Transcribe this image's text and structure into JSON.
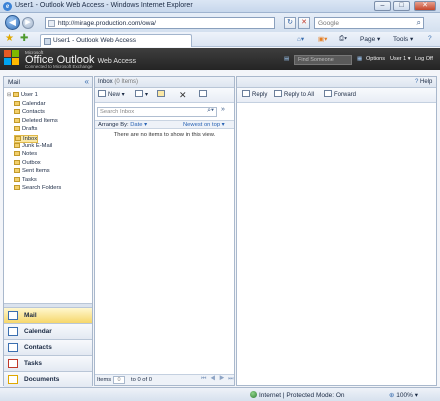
{
  "window": {
    "title": "User1 - Outlook Web Access - Windows Internet Explorer",
    "min_icon": "minimize-icon",
    "max_icon": "maximize-icon",
    "close_icon": "close-icon"
  },
  "address": {
    "url": "http://mirage.production.com/owa/",
    "refresh": "↻",
    "stop": "✕",
    "search_placeholder": "Google"
  },
  "tab": {
    "label": "User1 - Outlook Web Access"
  },
  "commands": {
    "page": "Page ▾",
    "tools": "Tools ▾",
    "help": "?"
  },
  "owa": {
    "microsoft": "Microsoft",
    "product": "Office Outlook",
    "product_suffix": "Web Access",
    "subtitle": "Connected to Microsoft Exchange",
    "find_placeholder": "Find Someone",
    "options": "Options",
    "user": "User 1 ▾",
    "logoff": "Log Off",
    "brand_colors": [
      "#e65a24",
      "#7fba00",
      "#00a4ef",
      "#ffb900"
    ]
  },
  "left": {
    "header": "Mail",
    "collapse": "«",
    "root": "User 1",
    "folders": [
      "Calendar",
      "Contacts",
      "Deleted Items",
      "Drafts",
      "Inbox",
      "Junk E-Mail",
      "Notes",
      "Outbox",
      "Sent Items",
      "Tasks",
      "Search Folders"
    ],
    "selected_folder": "Inbox",
    "nav": [
      "Mail",
      "Calendar",
      "Contacts",
      "Tasks",
      "Documents"
    ],
    "active_nav": "Mail"
  },
  "middle": {
    "folder": "Inbox",
    "count": "(0 Items)",
    "new": "New ▾",
    "search_placeholder": "Search Inbox",
    "arrange_label": "Arrange By:",
    "arrange_value": "Date ▾",
    "order": "Newest on top ▾",
    "empty": "There are no items to show in this view.",
    "items_label": "Items",
    "items_value": "0",
    "range": "to 0 of 0",
    "pager": "⏮ ◀ ▶ ⏭"
  },
  "reading": {
    "reply": "Reply",
    "reply_all": "Reply to All",
    "forward": "Forward",
    "help": "Help"
  },
  "status": {
    "zone": "Internet | Protected Mode: On",
    "zoom": "100% ▾"
  }
}
